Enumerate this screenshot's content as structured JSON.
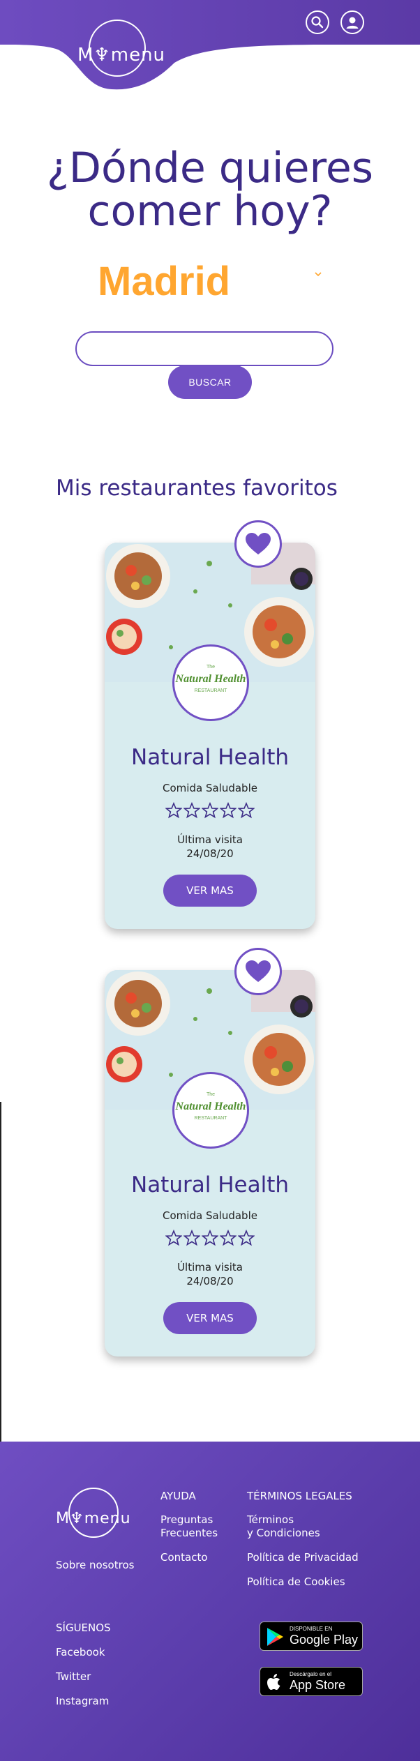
{
  "header": {
    "logo_text": "M♆menu",
    "search_icon": "search-icon",
    "user_icon": "user-icon",
    "brand_color": "#6a4bbf"
  },
  "hero": {
    "title_line1": "¿Dónde quieres",
    "title_line2": "comer hoy?",
    "city_selected": "Madrid",
    "city_color": "#ffa630",
    "search_placeholder": "",
    "search_value": "",
    "search_button_label": "BUSCAR"
  },
  "favorites": {
    "title": "Mis restaurantes favoritos",
    "cards": [
      {
        "logo_small": "The",
        "logo_main": "Natural Health",
        "logo_sub": "RESTAURANT",
        "name": "Natural Health",
        "category": "Comida Saludable",
        "rating": 0,
        "rating_max": 5,
        "visit_label": "Última visita",
        "visit_date": "24/08/20",
        "button_label": "VER MAS",
        "favorite_icon": "heart-icon"
      },
      {
        "logo_small": "The",
        "logo_main": "Natural Health",
        "logo_sub": "RESTAURANT",
        "name": "Natural Health",
        "category": "Comida Saludable",
        "rating": 0,
        "rating_max": 5,
        "visit_label": "Última visita",
        "visit_date": "24/08/20",
        "button_label": "VER MAS",
        "favorite_icon": "heart-icon"
      }
    ]
  },
  "footer": {
    "logo_text": "M♆menu",
    "about": "Sobre nosotros",
    "help": {
      "title": "AYUDA",
      "faq_line1": "Preguntas",
      "faq_line2": "Frecuentes",
      "contact": "Contacto"
    },
    "legal": {
      "title": "TÉRMINOS LEGALES",
      "terms_line1": "Términos",
      "terms_line2": "y Condiciones",
      "privacy": "Política de Privacidad",
      "cookies": "Política de Cookies"
    },
    "social": {
      "title": "SÍGUENOS",
      "facebook": "Facebook",
      "twitter": "Twitter",
      "instagram": "Instagram"
    },
    "google_play": {
      "small": "DISPONIBLE EN",
      "big": "Google Play"
    },
    "app_store": {
      "small": "Descárgalo en el",
      "big": "App Store"
    }
  }
}
